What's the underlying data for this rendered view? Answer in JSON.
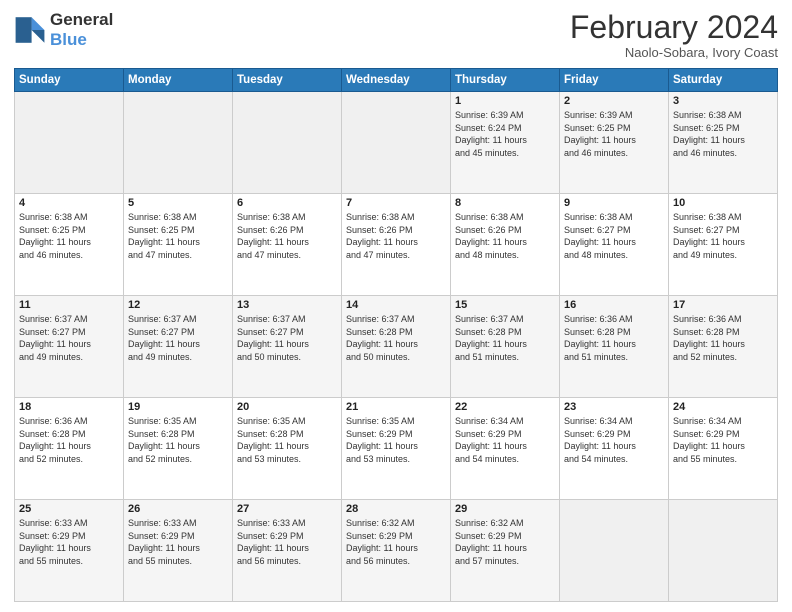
{
  "header": {
    "logo_line1": "General",
    "logo_line2": "Blue",
    "month_title": "February 2024",
    "location": "Naolo-Sobara, Ivory Coast"
  },
  "weekdays": [
    "Sunday",
    "Monday",
    "Tuesday",
    "Wednesday",
    "Thursday",
    "Friday",
    "Saturday"
  ],
  "weeks": [
    [
      {
        "day": "",
        "info": ""
      },
      {
        "day": "",
        "info": ""
      },
      {
        "day": "",
        "info": ""
      },
      {
        "day": "",
        "info": ""
      },
      {
        "day": "1",
        "info": "Sunrise: 6:39 AM\nSunset: 6:24 PM\nDaylight: 11 hours\nand 45 minutes."
      },
      {
        "day": "2",
        "info": "Sunrise: 6:39 AM\nSunset: 6:25 PM\nDaylight: 11 hours\nand 46 minutes."
      },
      {
        "day": "3",
        "info": "Sunrise: 6:38 AM\nSunset: 6:25 PM\nDaylight: 11 hours\nand 46 minutes."
      }
    ],
    [
      {
        "day": "4",
        "info": "Sunrise: 6:38 AM\nSunset: 6:25 PM\nDaylight: 11 hours\nand 46 minutes."
      },
      {
        "day": "5",
        "info": "Sunrise: 6:38 AM\nSunset: 6:25 PM\nDaylight: 11 hours\nand 47 minutes."
      },
      {
        "day": "6",
        "info": "Sunrise: 6:38 AM\nSunset: 6:26 PM\nDaylight: 11 hours\nand 47 minutes."
      },
      {
        "day": "7",
        "info": "Sunrise: 6:38 AM\nSunset: 6:26 PM\nDaylight: 11 hours\nand 47 minutes."
      },
      {
        "day": "8",
        "info": "Sunrise: 6:38 AM\nSunset: 6:26 PM\nDaylight: 11 hours\nand 48 minutes."
      },
      {
        "day": "9",
        "info": "Sunrise: 6:38 AM\nSunset: 6:27 PM\nDaylight: 11 hours\nand 48 minutes."
      },
      {
        "day": "10",
        "info": "Sunrise: 6:38 AM\nSunset: 6:27 PM\nDaylight: 11 hours\nand 49 minutes."
      }
    ],
    [
      {
        "day": "11",
        "info": "Sunrise: 6:37 AM\nSunset: 6:27 PM\nDaylight: 11 hours\nand 49 minutes."
      },
      {
        "day": "12",
        "info": "Sunrise: 6:37 AM\nSunset: 6:27 PM\nDaylight: 11 hours\nand 49 minutes."
      },
      {
        "day": "13",
        "info": "Sunrise: 6:37 AM\nSunset: 6:27 PM\nDaylight: 11 hours\nand 50 minutes."
      },
      {
        "day": "14",
        "info": "Sunrise: 6:37 AM\nSunset: 6:28 PM\nDaylight: 11 hours\nand 50 minutes."
      },
      {
        "day": "15",
        "info": "Sunrise: 6:37 AM\nSunset: 6:28 PM\nDaylight: 11 hours\nand 51 minutes."
      },
      {
        "day": "16",
        "info": "Sunrise: 6:36 AM\nSunset: 6:28 PM\nDaylight: 11 hours\nand 51 minutes."
      },
      {
        "day": "17",
        "info": "Sunrise: 6:36 AM\nSunset: 6:28 PM\nDaylight: 11 hours\nand 52 minutes."
      }
    ],
    [
      {
        "day": "18",
        "info": "Sunrise: 6:36 AM\nSunset: 6:28 PM\nDaylight: 11 hours\nand 52 minutes."
      },
      {
        "day": "19",
        "info": "Sunrise: 6:35 AM\nSunset: 6:28 PM\nDaylight: 11 hours\nand 52 minutes."
      },
      {
        "day": "20",
        "info": "Sunrise: 6:35 AM\nSunset: 6:28 PM\nDaylight: 11 hours\nand 53 minutes."
      },
      {
        "day": "21",
        "info": "Sunrise: 6:35 AM\nSunset: 6:29 PM\nDaylight: 11 hours\nand 53 minutes."
      },
      {
        "day": "22",
        "info": "Sunrise: 6:34 AM\nSunset: 6:29 PM\nDaylight: 11 hours\nand 54 minutes."
      },
      {
        "day": "23",
        "info": "Sunrise: 6:34 AM\nSunset: 6:29 PM\nDaylight: 11 hours\nand 54 minutes."
      },
      {
        "day": "24",
        "info": "Sunrise: 6:34 AM\nSunset: 6:29 PM\nDaylight: 11 hours\nand 55 minutes."
      }
    ],
    [
      {
        "day": "25",
        "info": "Sunrise: 6:33 AM\nSunset: 6:29 PM\nDaylight: 11 hours\nand 55 minutes."
      },
      {
        "day": "26",
        "info": "Sunrise: 6:33 AM\nSunset: 6:29 PM\nDaylight: 11 hours\nand 55 minutes."
      },
      {
        "day": "27",
        "info": "Sunrise: 6:33 AM\nSunset: 6:29 PM\nDaylight: 11 hours\nand 56 minutes."
      },
      {
        "day": "28",
        "info": "Sunrise: 6:32 AM\nSunset: 6:29 PM\nDaylight: 11 hours\nand 56 minutes."
      },
      {
        "day": "29",
        "info": "Sunrise: 6:32 AM\nSunset: 6:29 PM\nDaylight: 11 hours\nand 57 minutes."
      },
      {
        "day": "",
        "info": ""
      },
      {
        "day": "",
        "info": ""
      }
    ]
  ]
}
